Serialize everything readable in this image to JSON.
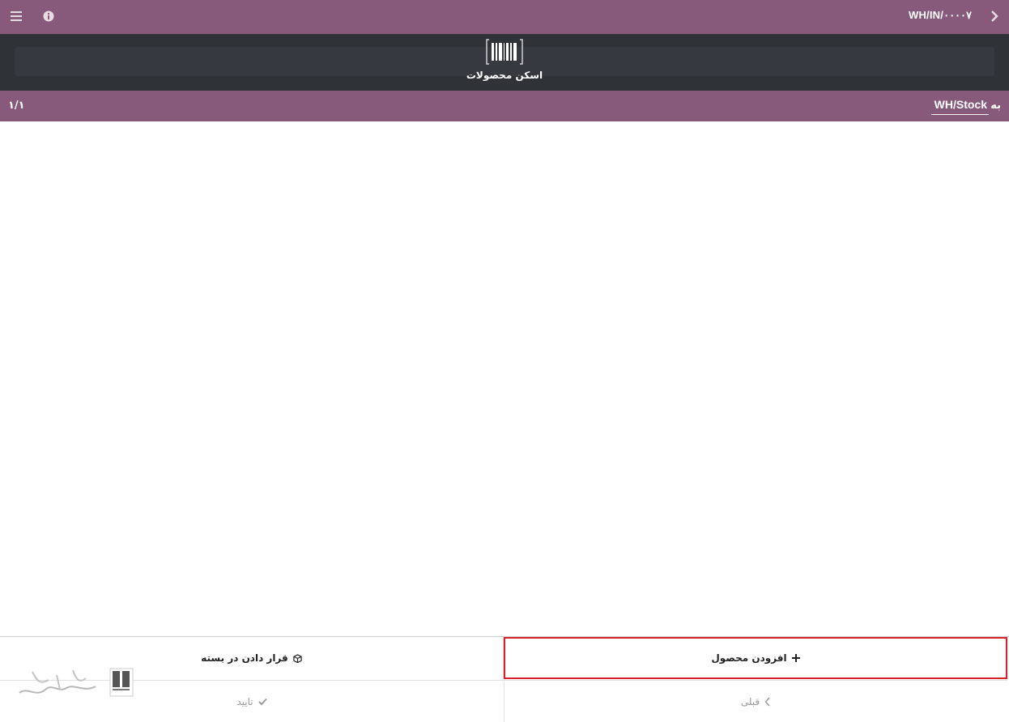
{
  "header": {
    "reference": "WH/IN/۰۰۰۰۷",
    "back_icon": "chevron-right-icon",
    "menu_icon": "hamburger-icon",
    "info_icon": "info-icon"
  },
  "scan": {
    "label": "اسکن محصولات",
    "icon": "barcode-icon"
  },
  "location": {
    "to_label": "به",
    "destination": "WH/Stock",
    "pager": "۱/۱"
  },
  "footer": {
    "add_product_label": "افزودن محصول",
    "put_in_pack_label": "قرار دادن در بسته",
    "previous_label": "قبلی",
    "confirm_label": "تایید"
  },
  "colors": {
    "brand": "#875a7b",
    "scan_bg": "#2f3237",
    "highlight": "#dc1f2a"
  }
}
